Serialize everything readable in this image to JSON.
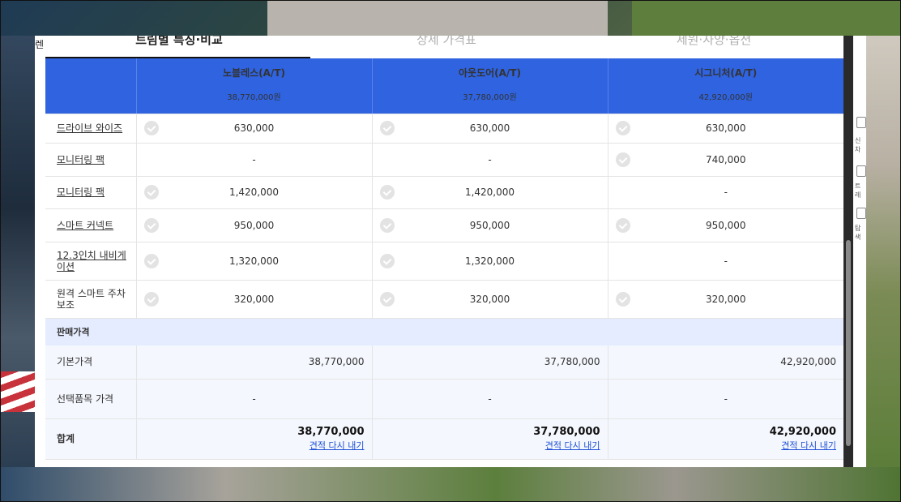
{
  "tabs": [
    {
      "label": "트림별 특징·비교",
      "active": true
    },
    {
      "label": "상세 가격표",
      "active": false
    },
    {
      "label": "제원·사양·옵션",
      "active": false
    }
  ],
  "trims": [
    {
      "name": "노블레스(A/T)",
      "price": "38,770,000원"
    },
    {
      "name": "아웃도어(A/T)",
      "price": "37,780,000원"
    },
    {
      "name": "시그니처(A/T)",
      "price": "42,920,000원"
    }
  ],
  "options": [
    {
      "label": "드라이브 와이즈",
      "link": true,
      "values": [
        "630,000",
        "630,000",
        "630,000"
      ],
      "checks": [
        true,
        true,
        true
      ]
    },
    {
      "label": "모니터링 팩",
      "link": true,
      "values": [
        "-",
        "-",
        "740,000"
      ],
      "checks": [
        false,
        false,
        true
      ]
    },
    {
      "label": "모니터링 팩",
      "link": true,
      "values": [
        "1,420,000",
        "1,420,000",
        "-"
      ],
      "checks": [
        true,
        true,
        false
      ]
    },
    {
      "label": "스마트 커넥트",
      "link": true,
      "values": [
        "950,000",
        "950,000",
        "950,000"
      ],
      "checks": [
        true,
        true,
        true
      ]
    },
    {
      "label": "12.3인치 내비게이션",
      "link": true,
      "values": [
        "1,320,000",
        "1,320,000",
        "-"
      ],
      "checks": [
        true,
        true,
        false
      ]
    },
    {
      "label": "원격 스마트 주차 보조",
      "link": false,
      "values": [
        "320,000",
        "320,000",
        "320,000"
      ],
      "checks": [
        true,
        true,
        true
      ]
    }
  ],
  "price_section": {
    "title": "판매가격",
    "base_label": "기본가격",
    "base_values": [
      "38,770,000",
      "37,780,000",
      "42,920,000"
    ],
    "options_label": "선택품목 가격",
    "options_values": [
      "-",
      "-",
      "-"
    ],
    "total_label": "합계",
    "total_values": [
      "38,770,000",
      "37,780,000",
      "42,920,000"
    ],
    "redo_label": "견적 다시 내기"
  },
  "side": {
    "left_text": "렌",
    "right_labels": [
      "신차",
      "트레",
      "탐색"
    ]
  },
  "colors": {
    "header_blue": "#2f63e0",
    "section_bg": "#e5ecff",
    "link_blue": "#1d4fd6"
  }
}
